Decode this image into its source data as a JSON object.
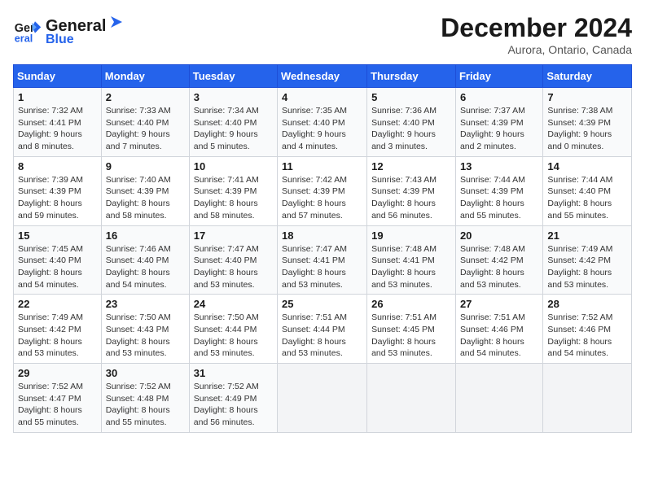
{
  "header": {
    "logo_line1": "General",
    "logo_line2": "Blue",
    "month": "December 2024",
    "location": "Aurora, Ontario, Canada"
  },
  "weekdays": [
    "Sunday",
    "Monday",
    "Tuesday",
    "Wednesday",
    "Thursday",
    "Friday",
    "Saturday"
  ],
  "weeks": [
    [
      {
        "day": "1",
        "sunrise": "7:32 AM",
        "sunset": "4:41 PM",
        "daylight": "9 hours and 8 minutes."
      },
      {
        "day": "2",
        "sunrise": "7:33 AM",
        "sunset": "4:40 PM",
        "daylight": "9 hours and 7 minutes."
      },
      {
        "day": "3",
        "sunrise": "7:34 AM",
        "sunset": "4:40 PM",
        "daylight": "9 hours and 5 minutes."
      },
      {
        "day": "4",
        "sunrise": "7:35 AM",
        "sunset": "4:40 PM",
        "daylight": "9 hours and 4 minutes."
      },
      {
        "day": "5",
        "sunrise": "7:36 AM",
        "sunset": "4:40 PM",
        "daylight": "9 hours and 3 minutes."
      },
      {
        "day": "6",
        "sunrise": "7:37 AM",
        "sunset": "4:39 PM",
        "daylight": "9 hours and 2 minutes."
      },
      {
        "day": "7",
        "sunrise": "7:38 AM",
        "sunset": "4:39 PM",
        "daylight": "9 hours and 0 minutes."
      }
    ],
    [
      {
        "day": "8",
        "sunrise": "7:39 AM",
        "sunset": "4:39 PM",
        "daylight": "8 hours and 59 minutes."
      },
      {
        "day": "9",
        "sunrise": "7:40 AM",
        "sunset": "4:39 PM",
        "daylight": "8 hours and 58 minutes."
      },
      {
        "day": "10",
        "sunrise": "7:41 AM",
        "sunset": "4:39 PM",
        "daylight": "8 hours and 58 minutes."
      },
      {
        "day": "11",
        "sunrise": "7:42 AM",
        "sunset": "4:39 PM",
        "daylight": "8 hours and 57 minutes."
      },
      {
        "day": "12",
        "sunrise": "7:43 AM",
        "sunset": "4:39 PM",
        "daylight": "8 hours and 56 minutes."
      },
      {
        "day": "13",
        "sunrise": "7:44 AM",
        "sunset": "4:39 PM",
        "daylight": "8 hours and 55 minutes."
      },
      {
        "day": "14",
        "sunrise": "7:44 AM",
        "sunset": "4:40 PM",
        "daylight": "8 hours and 55 minutes."
      }
    ],
    [
      {
        "day": "15",
        "sunrise": "7:45 AM",
        "sunset": "4:40 PM",
        "daylight": "8 hours and 54 minutes."
      },
      {
        "day": "16",
        "sunrise": "7:46 AM",
        "sunset": "4:40 PM",
        "daylight": "8 hours and 54 minutes."
      },
      {
        "day": "17",
        "sunrise": "7:47 AM",
        "sunset": "4:40 PM",
        "daylight": "8 hours and 53 minutes."
      },
      {
        "day": "18",
        "sunrise": "7:47 AM",
        "sunset": "4:41 PM",
        "daylight": "8 hours and 53 minutes."
      },
      {
        "day": "19",
        "sunrise": "7:48 AM",
        "sunset": "4:41 PM",
        "daylight": "8 hours and 53 minutes."
      },
      {
        "day": "20",
        "sunrise": "7:48 AM",
        "sunset": "4:42 PM",
        "daylight": "8 hours and 53 minutes."
      },
      {
        "day": "21",
        "sunrise": "7:49 AM",
        "sunset": "4:42 PM",
        "daylight": "8 hours and 53 minutes."
      }
    ],
    [
      {
        "day": "22",
        "sunrise": "7:49 AM",
        "sunset": "4:42 PM",
        "daylight": "8 hours and 53 minutes."
      },
      {
        "day": "23",
        "sunrise": "7:50 AM",
        "sunset": "4:43 PM",
        "daylight": "8 hours and 53 minutes."
      },
      {
        "day": "24",
        "sunrise": "7:50 AM",
        "sunset": "4:44 PM",
        "daylight": "8 hours and 53 minutes."
      },
      {
        "day": "25",
        "sunrise": "7:51 AM",
        "sunset": "4:44 PM",
        "daylight": "8 hours and 53 minutes."
      },
      {
        "day": "26",
        "sunrise": "7:51 AM",
        "sunset": "4:45 PM",
        "daylight": "8 hours and 53 minutes."
      },
      {
        "day": "27",
        "sunrise": "7:51 AM",
        "sunset": "4:46 PM",
        "daylight": "8 hours and 54 minutes."
      },
      {
        "day": "28",
        "sunrise": "7:52 AM",
        "sunset": "4:46 PM",
        "daylight": "8 hours and 54 minutes."
      }
    ],
    [
      {
        "day": "29",
        "sunrise": "7:52 AM",
        "sunset": "4:47 PM",
        "daylight": "8 hours and 55 minutes."
      },
      {
        "day": "30",
        "sunrise": "7:52 AM",
        "sunset": "4:48 PM",
        "daylight": "8 hours and 55 minutes."
      },
      {
        "day": "31",
        "sunrise": "7:52 AM",
        "sunset": "4:49 PM",
        "daylight": "8 hours and 56 minutes."
      },
      null,
      null,
      null,
      null
    ]
  ]
}
